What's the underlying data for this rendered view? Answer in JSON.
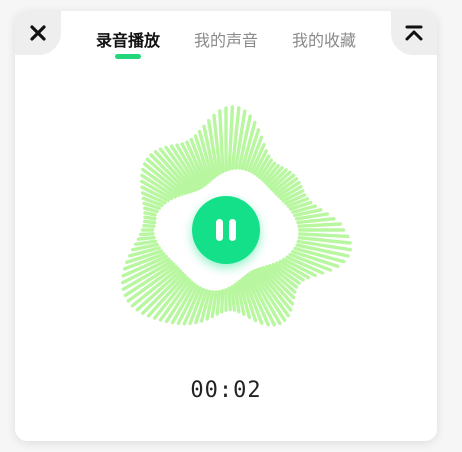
{
  "header": {
    "close_icon": "close-icon",
    "collapse_icon": "collapse-up-icon",
    "tabs": [
      {
        "label": "录音播放",
        "active": true
      },
      {
        "label": "我的声音",
        "active": false
      },
      {
        "label": "我的收藏",
        "active": false
      }
    ]
  },
  "player": {
    "state": "playing",
    "button_icon": "pause-icon",
    "time": "00:02"
  },
  "colors": {
    "accent": "#15e08a",
    "indicator": "#22d67a",
    "wave": "#b8f7a0"
  }
}
